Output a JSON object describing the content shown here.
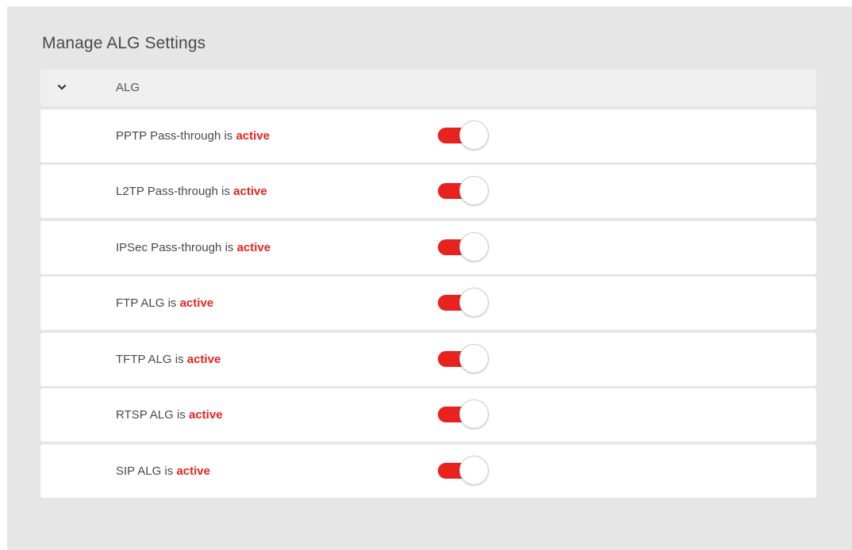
{
  "page": {
    "title": "Manage ALG Settings"
  },
  "group": {
    "label": "ALG",
    "expanded_icon": "chevron-down-icon"
  },
  "colors": {
    "accent": "#e8231f",
    "panel_bg": "#e6e6e6",
    "row_bg": "#ffffff"
  },
  "rows": [
    {
      "label": "PPTP Pass-through is ",
      "state": "active",
      "enabled": true
    },
    {
      "label": "L2TP Pass-through is ",
      "state": "active",
      "enabled": true
    },
    {
      "label": "IPSec Pass-through is ",
      "state": "active",
      "enabled": true
    },
    {
      "label": "FTP ALG is ",
      "state": "active",
      "enabled": true
    },
    {
      "label": "TFTP ALG is ",
      "state": "active",
      "enabled": true
    },
    {
      "label": "RTSP ALG is ",
      "state": "active",
      "enabled": true
    },
    {
      "label": "SIP ALG is ",
      "state": "active",
      "enabled": true
    }
  ]
}
